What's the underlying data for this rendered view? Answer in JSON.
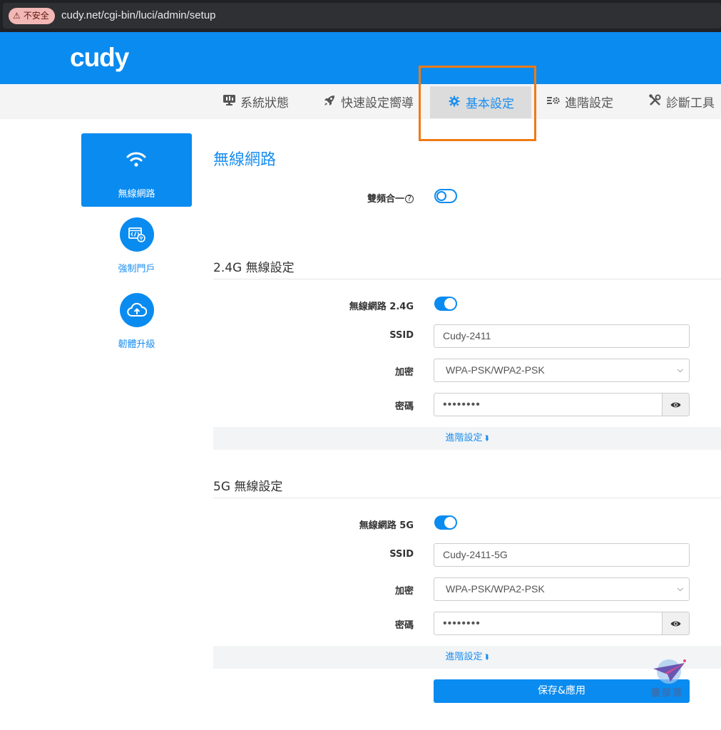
{
  "browser": {
    "security_label": "不安全",
    "url": "cudy.net/cgi-bin/luci/admin/setup"
  },
  "header": {
    "logo": "cudy"
  },
  "nav": {
    "items": [
      {
        "label": "系統狀態",
        "icon": "monitor-icon"
      },
      {
        "label": "快速設定嚮導",
        "icon": "rocket-icon"
      },
      {
        "label": "基本設定",
        "icon": "gear-icon",
        "active": true
      },
      {
        "label": "進階設定",
        "icon": "advanced-settings-icon"
      },
      {
        "label": "診斷工具",
        "icon": "tools-icon"
      }
    ]
  },
  "sidebar": {
    "items": [
      {
        "label": "無線網路",
        "icon": "wifi-icon",
        "active": true
      },
      {
        "label": "強制門戶",
        "icon": "captive-portal-icon"
      },
      {
        "label": "韌體升級",
        "icon": "cloud-upload-icon"
      }
    ]
  },
  "main": {
    "title": "無線網路",
    "band_steering": {
      "label": "雙頻合一",
      "help": "?",
      "enabled": false
    },
    "band_24": {
      "section_title": "2.4G 無線設定",
      "enable_label": "無線網路 2.4G",
      "enabled": true,
      "ssid_label": "SSID",
      "ssid_value": "Cudy-2411",
      "encryption_label": "加密",
      "encryption_value": "WPA-PSK/WPA2-PSK",
      "password_label": "密碼",
      "password_value": "••••••••",
      "advanced_label": "進階設定"
    },
    "band_5": {
      "section_title": "5G 無線設定",
      "enable_label": "無線網路 5G",
      "enabled": true,
      "ssid_label": "SSID",
      "ssid_value": "Cudy-2411-5G",
      "encryption_label": "加密",
      "encryption_value": "WPA-PSK/WPA2-PSK",
      "password_label": "密碼",
      "password_value": "••••••••",
      "advanced_label": "進階設定"
    },
    "save_label": "保存&應用"
  },
  "watermark": {
    "text": "塵部落"
  },
  "colors": {
    "brand": "#0a8bf0",
    "highlight": "#f07a14"
  }
}
